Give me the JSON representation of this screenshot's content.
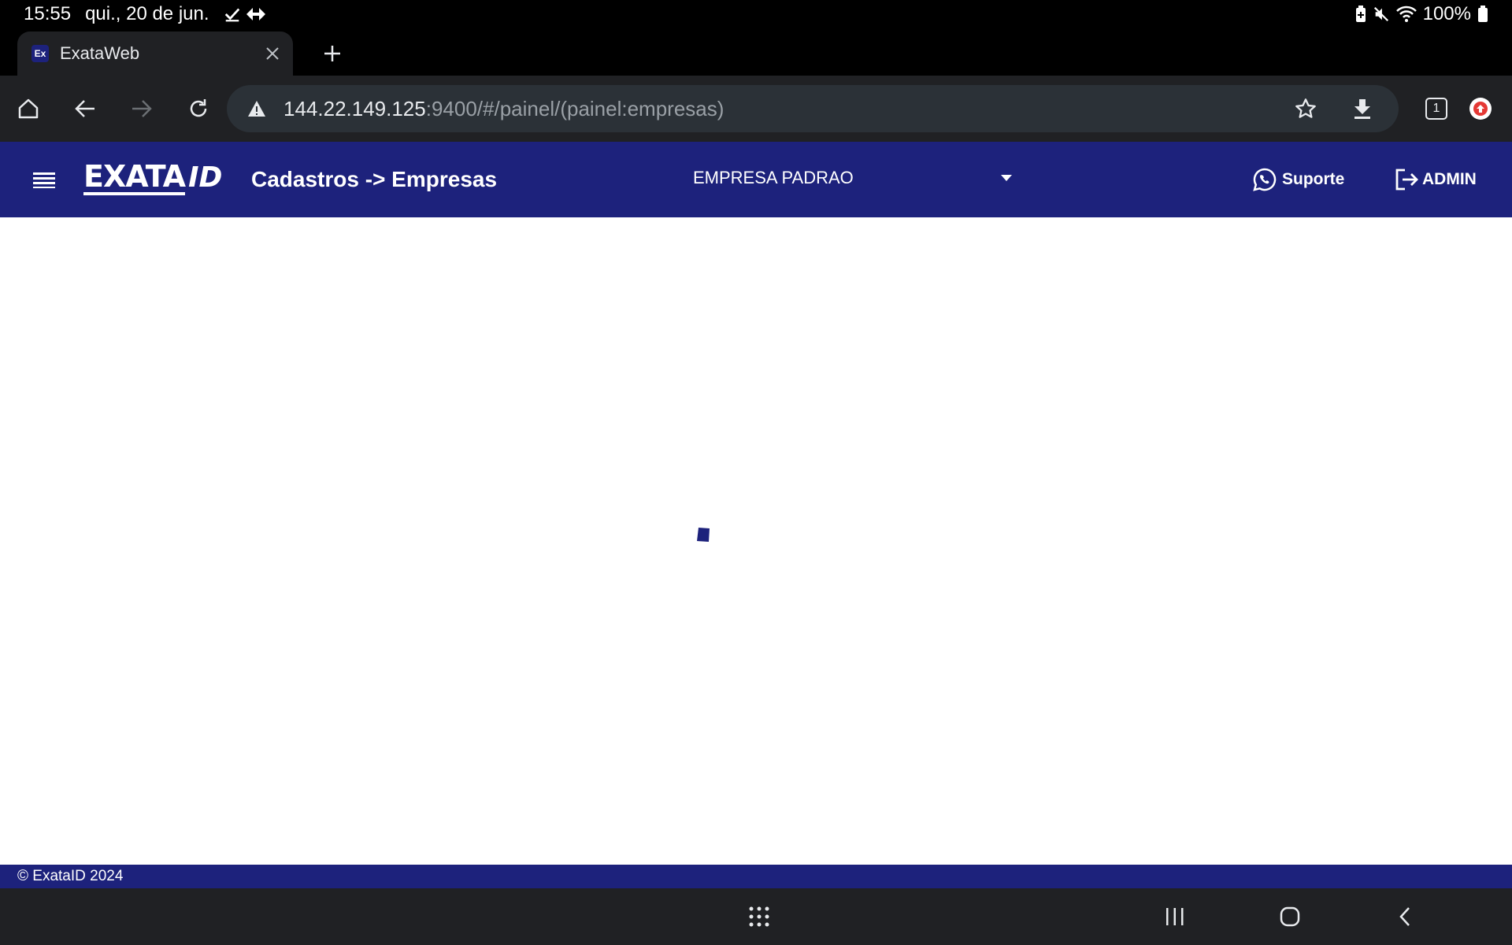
{
  "status_bar": {
    "time": "15:55",
    "date": "qui., 20 de jun.",
    "battery": "100%",
    "icons_left": [
      "check-icon",
      "diamond-arrows-icon"
    ],
    "icons_right": [
      "battery-saver-icon",
      "mute-icon",
      "wifi-icon",
      "battery-icon"
    ]
  },
  "browser": {
    "tab": {
      "favicon": "Ex",
      "title": "ExataWeb"
    },
    "url": {
      "host": "144.22.149.125",
      "rest": ":9400/#/painel/(painel:empresas)"
    },
    "tab_count": "1"
  },
  "app": {
    "logo_main": "EXATA",
    "logo_suffix": "ID",
    "page_title": "Cadastros -> Empresas",
    "company_selected": "EMPRESA PADRAO",
    "support_label": "Suporte",
    "user_label": "ADMIN",
    "footer": "© ExataID 2024",
    "brand_color": "#1d227c"
  }
}
